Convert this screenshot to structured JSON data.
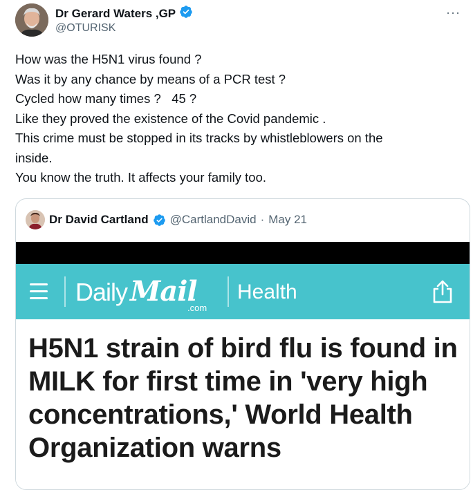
{
  "author": {
    "name": "Dr Gerard Waters ,GP",
    "handle": "@OTURISK",
    "verified": true
  },
  "more_label": "···",
  "tweet_lines": [
    "How was the H5N1 virus found ?",
    "Was it by any chance by means of a PCR test ?",
    "Cycled how many times ?   45 ?",
    "Like they proved the existence of the Covid pandemic .",
    "This crime must be stopped in its tracks by whistleblowers on the",
    "inside.",
    "You know the truth. It affects your family too."
  ],
  "quoted": {
    "name": "Dr David Cartland",
    "handle": "@CartlandDavid",
    "separator": "·",
    "date": "May 21",
    "verified": true,
    "media": {
      "brand_part1": "Daily",
      "brand_part2": "Mail",
      "brand_suffix": ".com",
      "section": "Health",
      "headline": "H5N1 strain of bird flu is found in MILK for first time in 'very high concentrations,' World Health Organization warns"
    }
  },
  "colors": {
    "verified_badge": "#1d9bf0",
    "dailymail_teal": "#47c3cc",
    "secondary_text": "#536471"
  },
  "icons": {
    "verified": "verified-badge-icon",
    "menu": "hamburger-menu-icon",
    "share": "share-icon",
    "more": "more-options-icon"
  }
}
